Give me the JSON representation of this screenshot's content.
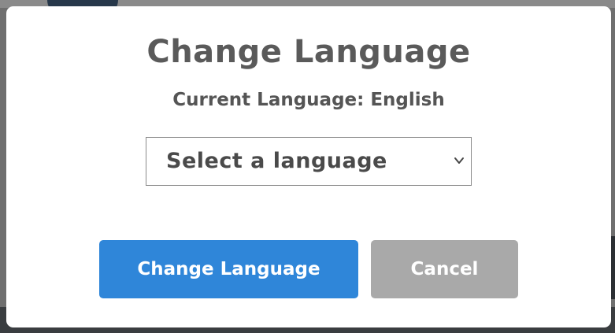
{
  "modal": {
    "title": "Change Language",
    "current_language": "Current Language: English",
    "select": {
      "selected_label": "Select a language",
      "icon": "chevron-down-icon"
    },
    "buttons": {
      "change_label": "Change Language",
      "cancel_label": "Cancel"
    }
  },
  "colors": {
    "primary": "#2f86d9",
    "secondary": "#a9a9a9",
    "title_text": "#5a5a5a",
    "overlay": "#6f6f6f"
  }
}
